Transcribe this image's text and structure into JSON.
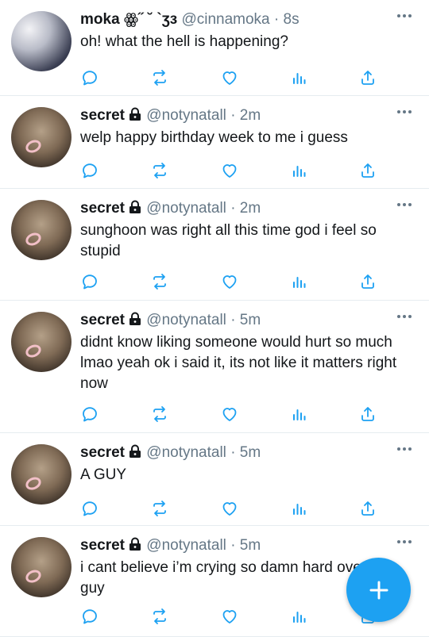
{
  "tweets": [
    {
      "display_name": "moka ꙮ˝ ˘ `ʒɜ",
      "handle": "@cinnamoka",
      "time": "8s",
      "text": "oh! what the hell is happening?",
      "avatar": "moka"
    },
    {
      "display_name": "secret",
      "handle": "@notynatall",
      "time": "2m",
      "text": "welp happy birthday week to me i guess",
      "avatar": "secret"
    },
    {
      "display_name": "secret",
      "handle": "@notynatall",
      "time": "2m",
      "text": "sunghoon was right all this time god i feel so stupid",
      "avatar": "secret"
    },
    {
      "display_name": "secret",
      "handle": "@notynatall",
      "time": "5m",
      "text": "didnt know liking someone would hurt so much lmao yeah ok i said it, its not like it matters right now",
      "avatar": "secret"
    },
    {
      "display_name": "secret",
      "handle": "@notynatall",
      "time": "5m",
      "text": "A GUY",
      "avatar": "secret"
    },
    {
      "display_name": "secret",
      "handle": "@notynatall",
      "time": "5m",
      "text": "i cant believe i’m crying so damn hard over a guy",
      "avatar": "secret"
    }
  ],
  "separator": "·",
  "colors": {
    "accent": "#1da1f2",
    "icon": "#1da1f2",
    "muted": "#657786"
  },
  "compose_icon": "plus-icon"
}
